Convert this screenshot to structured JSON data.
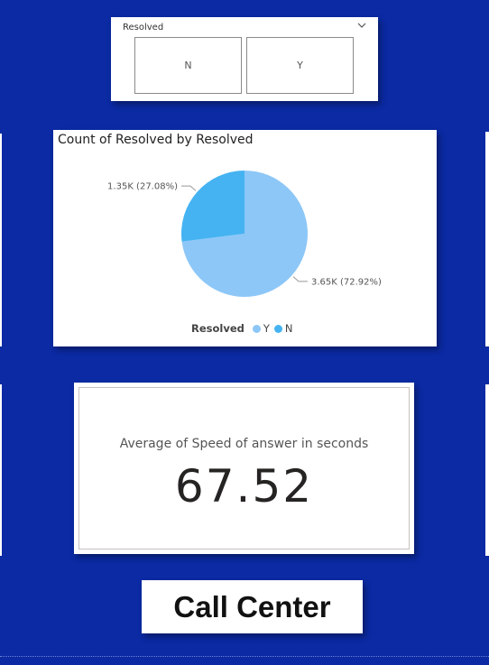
{
  "slicer": {
    "header": "Resolved",
    "options": [
      "N",
      "Y"
    ]
  },
  "pie": {
    "title": "Count of Resolved by Resolved",
    "legend_title": "Resolved",
    "colors": {
      "Y": "#8dc7f7",
      "N": "#45b3f2"
    },
    "chart_data": {
      "type": "pie",
      "title": "Count of Resolved by Resolved",
      "legend": {
        "title": "Resolved",
        "entries": [
          "Y",
          "N"
        ],
        "placement": "bottom"
      },
      "slices": [
        {
          "name": "Y",
          "value": 3650,
          "percent": 72.92,
          "label": "3.65K (72.92%)"
        },
        {
          "name": "N",
          "value": 1350,
          "percent": 27.08,
          "label": "1.35K (27.08%)"
        }
      ]
    }
  },
  "kpi": {
    "label": "Average of Speed of answer in seconds",
    "value": "67.52"
  },
  "page_title": "Call Center"
}
